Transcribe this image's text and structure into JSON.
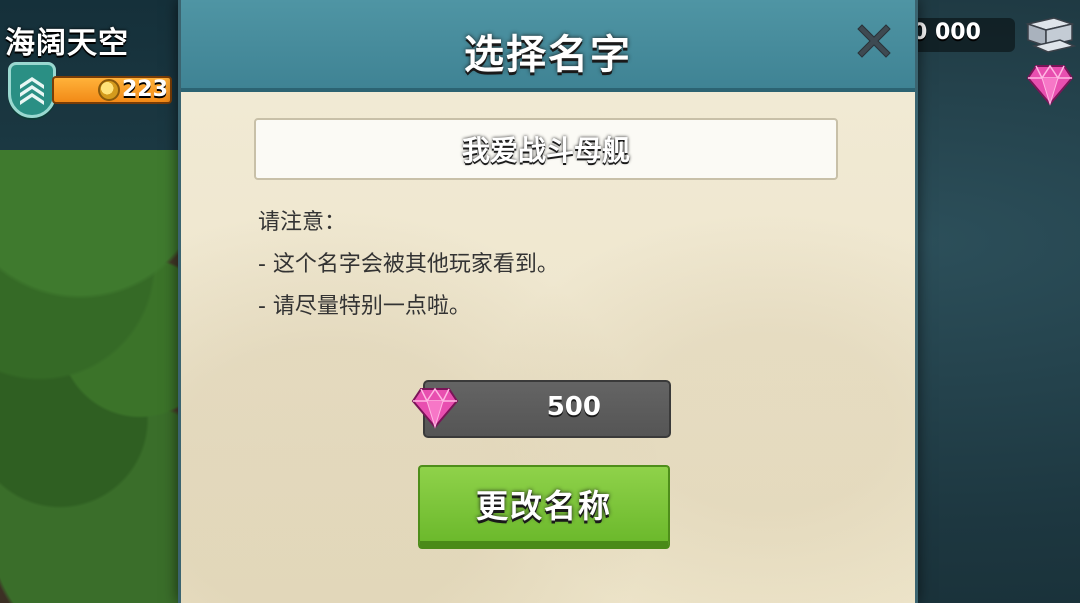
{
  "hud": {
    "player_name": "海阔天空",
    "rank_icon": "chevron-rank-icon",
    "xp_value": "223",
    "resource_value": "0 000",
    "resource_icon": "steel-icon",
    "gem_icon": "gem-icon"
  },
  "dialog": {
    "title": "选择名字",
    "close_icon": "close-icon",
    "name_value": "我爱战斗母舰",
    "notice": {
      "heading": "请注意：",
      "line1": "- 这个名字会被其他玩家看到。",
      "line2": "- 请尽量特别一点啦。"
    },
    "cost": {
      "icon": "gem-icon",
      "value": "500"
    },
    "change_button_label": "更改名称"
  },
  "colors": {
    "header": "#4a8fa0",
    "panel": "#f0e8d2",
    "button_green": "#7cc63a",
    "cost_box": "#5b5b5b",
    "gem": "#e84fb0"
  }
}
